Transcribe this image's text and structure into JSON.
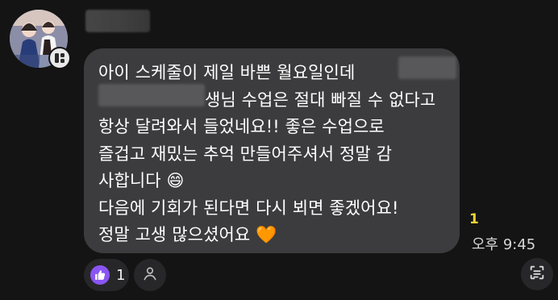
{
  "message": {
    "lines": [
      "아이 스케줄이 제일 바쁜 월요일인데 ",
      "생님 수업은 절대 빠질 수 없다고",
      "항상 달려와서 들었네요!! 좋은 수업으로",
      "즐겁고 재밌는 추억 만들어주셔서 정말 감",
      "사합니다 😄",
      "다음에 기회가 된다면 다시 뵈면 좋겠어요!",
      "정말 고생 많으셨어요 🧡"
    ],
    "unread_count": "1",
    "time": "오후 9:45"
  },
  "reactions": {
    "like_count": "1"
  },
  "icons": {
    "profile_badge": "profile-badge-icon",
    "like": "thumbs-up-icon",
    "user": "user-icon",
    "text_select": "text-select-icon"
  }
}
